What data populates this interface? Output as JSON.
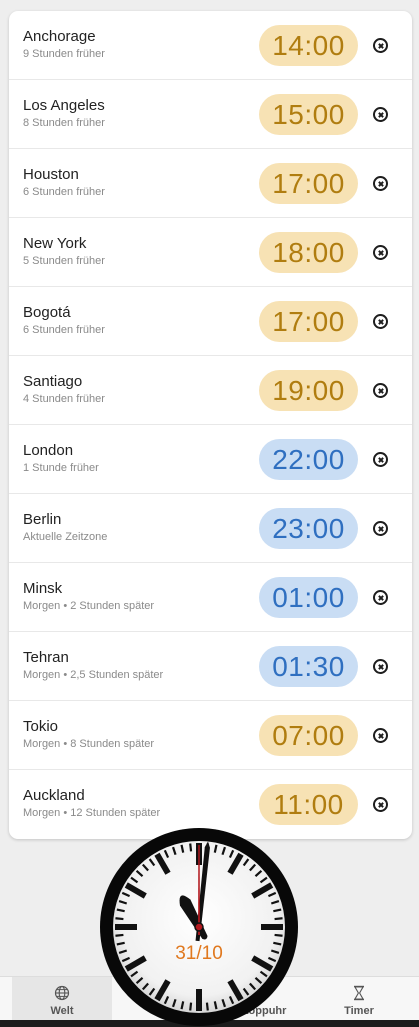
{
  "world_clocks": [
    {
      "city": "Anchorage",
      "offset": "9 Stunden früher",
      "time": "14:00",
      "period": "day"
    },
    {
      "city": "Los Angeles",
      "offset": "8 Stunden früher",
      "time": "15:00",
      "period": "day"
    },
    {
      "city": "Houston",
      "offset": "6 Stunden früher",
      "time": "17:00",
      "period": "day"
    },
    {
      "city": "New York",
      "offset": "5 Stunden früher",
      "time": "18:00",
      "period": "day"
    },
    {
      "city": "Bogotá",
      "offset": "6 Stunden früher",
      "time": "17:00",
      "period": "day"
    },
    {
      "city": "Santiago",
      "offset": "4 Stunden früher",
      "time": "19:00",
      "period": "day"
    },
    {
      "city": "London",
      "offset": "1 Stunde früher",
      "time": "22:00",
      "period": "night"
    },
    {
      "city": "Berlin",
      "offset": "Aktuelle Zeitzone",
      "time": "23:00",
      "period": "night"
    },
    {
      "city": "Minsk",
      "offset": "Morgen • 2 Stunden später",
      "time": "01:00",
      "period": "night"
    },
    {
      "city": "Tehran",
      "offset": "Morgen • 2,5 Stunden später",
      "time": "01:30",
      "period": "night"
    },
    {
      "city": "Tokio",
      "offset": "Morgen • 8 Stunden später",
      "time": "07:00",
      "period": "day"
    },
    {
      "city": "Auckland",
      "offset": "Morgen • 12 Stunden später",
      "time": "11:00",
      "period": "day"
    }
  ],
  "colors": {
    "day_bg": "#f7e2b4",
    "day_text": "#b07d10",
    "night_bg": "#c9ddf4",
    "night_text": "#2f6fc0",
    "date_text": "#e0781e",
    "second_hand": "#b3191f"
  },
  "analog_clock": {
    "date": "31/10",
    "hour": 11,
    "minute": 1,
    "second": 0
  },
  "nav": {
    "items": [
      {
        "label": "Welt",
        "icon": "globe-icon",
        "active": true
      },
      {
        "label": "",
        "icon": "alarm-icon",
        "active": false
      },
      {
        "label": "Stoppuhr",
        "icon": "stopwatch-icon",
        "active": false
      },
      {
        "label": "Timer",
        "icon": "hourglass-icon",
        "active": false
      }
    ]
  }
}
